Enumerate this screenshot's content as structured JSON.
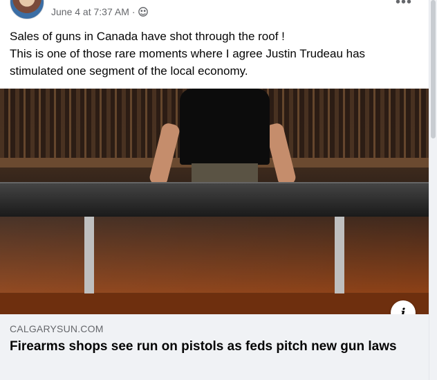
{
  "post": {
    "timestamp": "June 4 at 7:37 AM",
    "separator": "·",
    "audience_icon": "public-globe-icon",
    "more_icon": "more-options-icon",
    "more_text": "•••",
    "text_lines": [
      "Sales of guns in Canada have shot through the roof !",
      "This is one of those rare moments where I agree Justin Trudeau has stimulated one segment of the local economy."
    ]
  },
  "link_preview": {
    "domain": "CALGARYSUN.COM",
    "headline": "Firearms shops see run on pistols as feds pitch new gun laws",
    "info_icon": "info-icon",
    "info_text": "i"
  },
  "colors": {
    "text_primary": "#050505",
    "text_secondary": "#65676b",
    "preview_bg": "#f0f2f5"
  }
}
